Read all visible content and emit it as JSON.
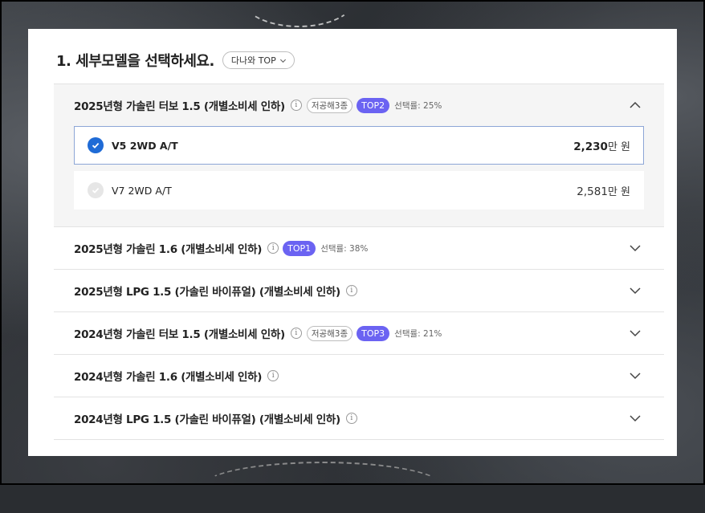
{
  "header": {
    "title": "1. 세부모델을 선택하세요.",
    "sort_label": "다나와 TOP"
  },
  "sections": [
    {
      "title": "2025년형 가솔린 터보 1.5 (개별소비세 인하)",
      "low_emission": "저공해3종",
      "top_badge": "TOP2",
      "rate": "선택률: 25%",
      "expanded": true,
      "options": [
        {
          "name": "V5 2WD A/T",
          "price": "2,230",
          "unit": "만 원",
          "selected": true
        },
        {
          "name": "V7 2WD A/T",
          "price": "2,581",
          "unit": "만 원",
          "selected": false
        }
      ]
    },
    {
      "title": "2025년형 가솔린 1.6 (개별소비세 인하)",
      "top_badge": "TOP1",
      "rate": "선택률: 38%"
    },
    {
      "title": "2025년형 LPG 1.5 (가솔린 바이퓨얼) (개별소비세 인하)"
    },
    {
      "title": "2024년형 가솔린 터보 1.5 (개별소비세 인하)",
      "low_emission": "저공해3종",
      "top_badge": "TOP3",
      "rate": "선택률: 21%"
    },
    {
      "title": "2024년형 가솔린 1.6 (개별소비세 인하)"
    },
    {
      "title": "2024년형 LPG 1.5 (가솔린 바이퓨얼) (개별소비세 인하)"
    }
  ],
  "colors": {
    "top_badge": "#6b63f2",
    "check_selected": "#1f6bd6",
    "selected_border": "#8da6d6"
  },
  "icons": {
    "info": "info-icon",
    "collapse": "chevron-up-icon",
    "expand": "chevron-down-icon",
    "check": "check-icon"
  }
}
